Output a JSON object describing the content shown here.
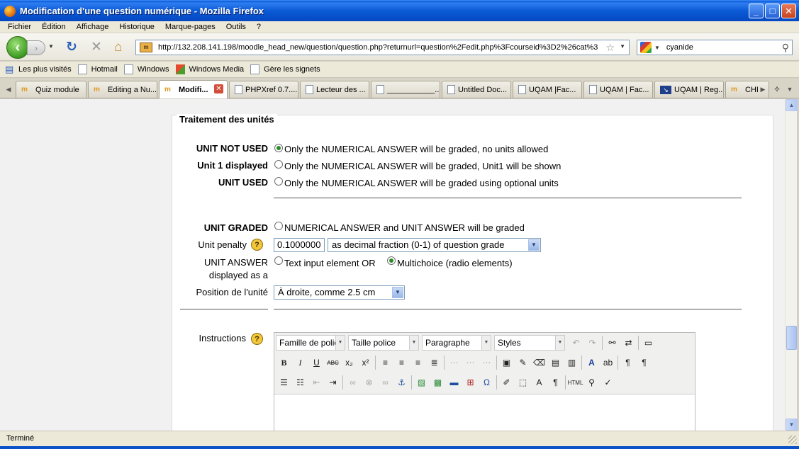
{
  "window": {
    "title": "Modification d'une question numérique - Mozilla Firefox",
    "controls": [
      "minimize-icon",
      "maximize-icon",
      "close-icon"
    ]
  },
  "menubar": [
    "Fichier",
    "Édition",
    "Affichage",
    "Historique",
    "Marque-pages",
    "Outils",
    "?"
  ],
  "nav": {
    "url": "http://132.208.141.198/moodle_head_new/question/question.php?returnurl=question%2Fedit.php%3Fcourseid%3D2%26cat%3",
    "search_value": "cyanide",
    "site_icon_text": "m"
  },
  "bookmarks": [
    "Les plus visités",
    "Hotmail",
    "Windows",
    "Windows Media",
    "Gère les signets"
  ],
  "tabs": [
    {
      "label": "Quiz module",
      "icon": "moodle"
    },
    {
      "label": "Editing a Nu...",
      "icon": "moodle"
    },
    {
      "label": "Modifi...",
      "icon": "moodle",
      "active": true
    },
    {
      "label": "PHPXref 0.7....",
      "icon": "doc"
    },
    {
      "label": "Lecteur des ...",
      "icon": "doc"
    },
    {
      "label": "___________...",
      "icon": "doc"
    },
    {
      "label": "Untitled Doc...",
      "icon": "doc"
    },
    {
      "label": "UQAM |Fac...",
      "icon": "doc"
    },
    {
      "label": "UQAM | Fac...",
      "icon": "doc"
    },
    {
      "label": "UQAM | Reg...",
      "icon": "uqam"
    },
    {
      "label": "CHI",
      "icon": "moodle"
    }
  ],
  "form": {
    "legend": "Traitement des unités",
    "unit_options": [
      {
        "label": "UNIT NOT USED",
        "text": "Only the NUMERICAL ANSWER will be graded, no units allowed",
        "checked": true
      },
      {
        "label": "Unit 1 displayed",
        "text": "Only the NUMERICAL ANSWER will be graded, Unit1 will be shown",
        "checked": false
      },
      {
        "label": "UNIT USED",
        "text": "Only the NUMERICAL ANSWER will be graded using optional units",
        "checked": false
      }
    ],
    "unit_graded": {
      "label": "UNIT GRADED",
      "text": " NUMERICAL ANSWER and UNIT ANSWER will be graded",
      "checked": false
    },
    "unit_penalty": {
      "label": "Unit penalty",
      "value": "0.1000000",
      "select": "as decimal fraction (0-1) of question grade"
    },
    "unit_answer": {
      "label_line1": "UNIT ANSWER",
      "label_line2": "displayed as a",
      "option1": "Text input element OR ",
      "option2": "Multichoice (radio elements)",
      "option1_checked": false,
      "option2_checked": true
    },
    "position": {
      "label": "Position de l'unité",
      "select": "À droite, comme 2.5 cm"
    },
    "instructions": {
      "label": "Instructions"
    },
    "help_glyph": "?"
  },
  "editor": {
    "font_family": "Famille de polic",
    "font_size": "Taille police",
    "format": "Paragraphe",
    "styles": "Styles"
  },
  "status": "Terminé"
}
